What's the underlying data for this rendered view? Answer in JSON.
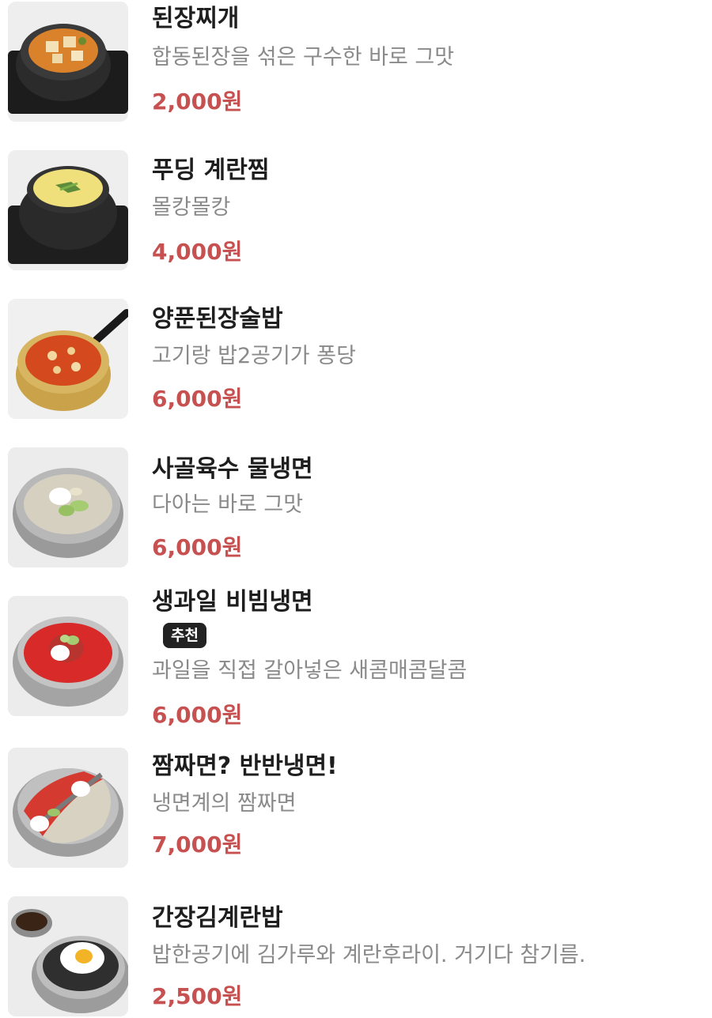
{
  "menu": {
    "items": [
      {
        "name": "된장찌개",
        "description": "합동된장을 섞은 구수한 바로 그맛",
        "price": "2,000원",
        "image_icon": "doenjang-jjigae-image"
      },
      {
        "name": "푸딩 계란찜",
        "description": "몰캉몰캉",
        "price": "4,000원",
        "image_icon": "steamed-egg-image"
      },
      {
        "name": "양푼된장술밥",
        "description": "고기랑 밥2공기가 퐁당",
        "price": "6,000원",
        "image_icon": "doenjang-sulbap-image"
      },
      {
        "name": "사골육수 물냉면",
        "description": "다아는 바로 그맛",
        "price": "6,000원",
        "image_icon": "mul-naengmyeon-image"
      },
      {
        "name": "생과일 비빔냉면",
        "badge": "추천",
        "description": "과일을 직접 갈아넣은 새콤매콤달콤",
        "price": "6,000원",
        "image_icon": "bibim-naengmyeon-image"
      },
      {
        "name": "짬짜면? 반반냉면!",
        "description": "냉면계의 짬짜면",
        "price": "7,000원",
        "image_icon": "half-half-naengmyeon-image"
      },
      {
        "name": "간장김계란밥",
        "description": "밥한공기에 김가루와 계란후라이. 거기다 참기름.",
        "price": "2,500원",
        "image_icon": "soy-egg-rice-image"
      }
    ]
  },
  "colors": {
    "name": "#1e1e1e",
    "description": "#8a8a8a",
    "price": "#c75050",
    "badge_bg": "#222222"
  }
}
